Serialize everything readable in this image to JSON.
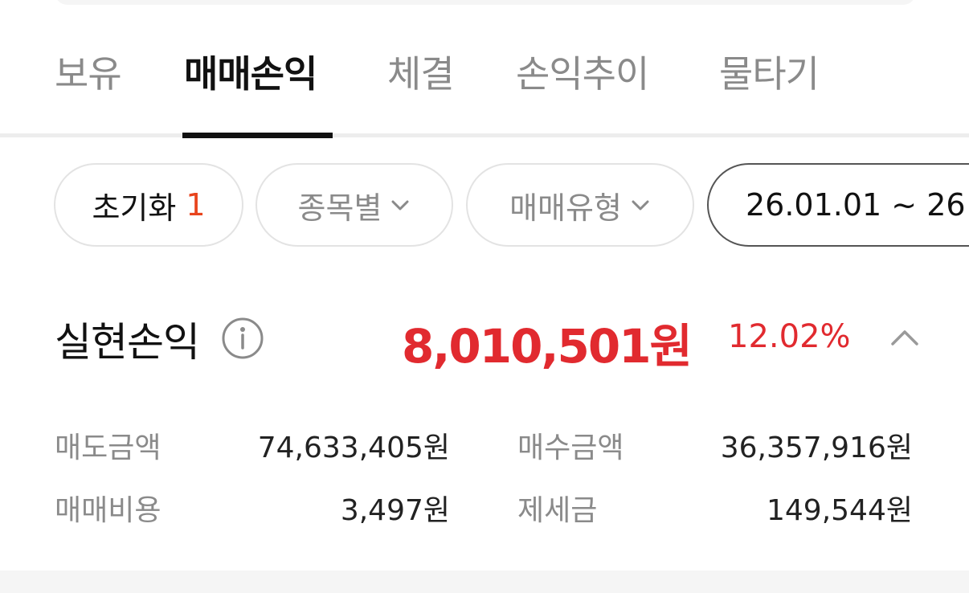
{
  "tabs": [
    {
      "label": "보유"
    },
    {
      "label": "매매손익"
    },
    {
      "label": "체결"
    },
    {
      "label": "손익추이"
    },
    {
      "label": "물타기"
    }
  ],
  "active_tab": "매매손익",
  "filters": {
    "reset_label": "초기화",
    "reset_count": "1",
    "stock_label": "종목별",
    "type_label": "매매유형",
    "date_range": "26.01.01 ~ 26"
  },
  "summary": {
    "title": "실현손익",
    "amount": "8,010,501원",
    "rate": "12.02%"
  },
  "details": {
    "sell_amount_label": "매도금액",
    "sell_amount_value": "74,633,405원",
    "buy_amount_label": "매수금액",
    "buy_amount_value": "36,357,916원",
    "trade_cost_label": "매매비용",
    "trade_cost_value": "3,497원",
    "tax_label": "제세금",
    "tax_value": "149,544원"
  },
  "colors": {
    "profit": "#e12a2f",
    "badge": "#e8441d",
    "muted": "#8a8a8a"
  },
  "icons": {
    "info": "info-icon",
    "dropdown": "chevron-down-icon",
    "collapse": "chevron-up-icon"
  }
}
